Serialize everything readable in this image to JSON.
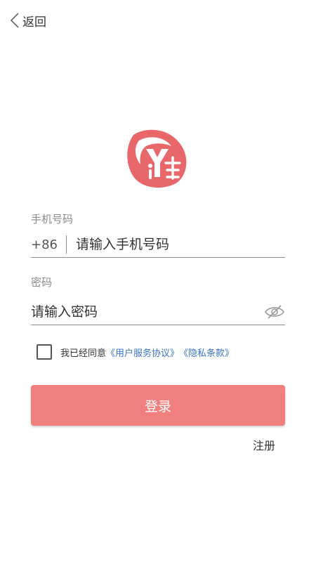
{
  "header": {
    "back_label": "返回",
    "back_icon": "chevron-left-icon"
  },
  "logo": {
    "icon": "brand-logo-icon",
    "color": "#e8676b"
  },
  "phone": {
    "label": "手机号码",
    "country_code": "+86",
    "placeholder": "请输入手机号码",
    "value": ""
  },
  "password": {
    "label": "密码",
    "placeholder": "请输入密码",
    "value": "",
    "visibility_icon": "eye-off-icon"
  },
  "agreement": {
    "checked": false,
    "prefix": "我已经同意",
    "user_agreement": "《用户服务协议》",
    "privacy_policy": "《隐私条款》",
    "link_color": "#3b74c9"
  },
  "actions": {
    "login_label": "登录",
    "login_color": "#f08080",
    "register_label": "注册"
  }
}
